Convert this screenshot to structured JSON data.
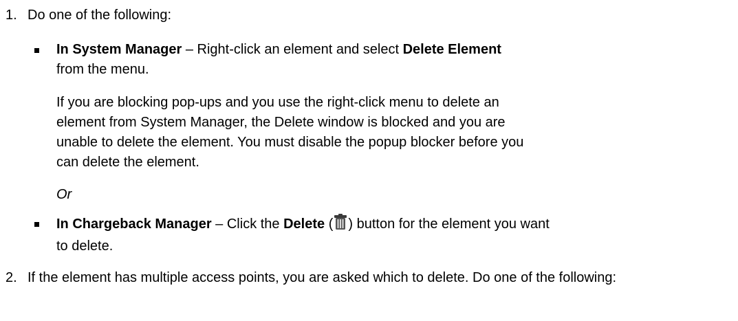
{
  "steps": [
    {
      "number": "1.",
      "text": "Do one of the following:"
    },
    {
      "number": "2.",
      "text": "If the element has multiple access points, you are asked which to delete. Do one of the following:"
    }
  ],
  "options": {
    "system_manager": {
      "label": "In System Manager",
      "text_before": " – Right-click an element and select ",
      "action": "Delete Element",
      "text_after": " from the menu."
    },
    "note": "If you are blocking pop-ups and you use the right-click menu to delete an element from System Manager, the Delete window is blocked and you are unable to delete the element. You must disable the popup blocker before you can delete the element.",
    "or_label": "Or",
    "chargeback_manager": {
      "label": "In Chargeback Manager",
      "text_before": " – Click the ",
      "action": "Delete",
      "paren_open": " (",
      "icon": "trash-icon",
      "paren_close": ")",
      "text_after": " button for the element you want to delete."
    }
  }
}
